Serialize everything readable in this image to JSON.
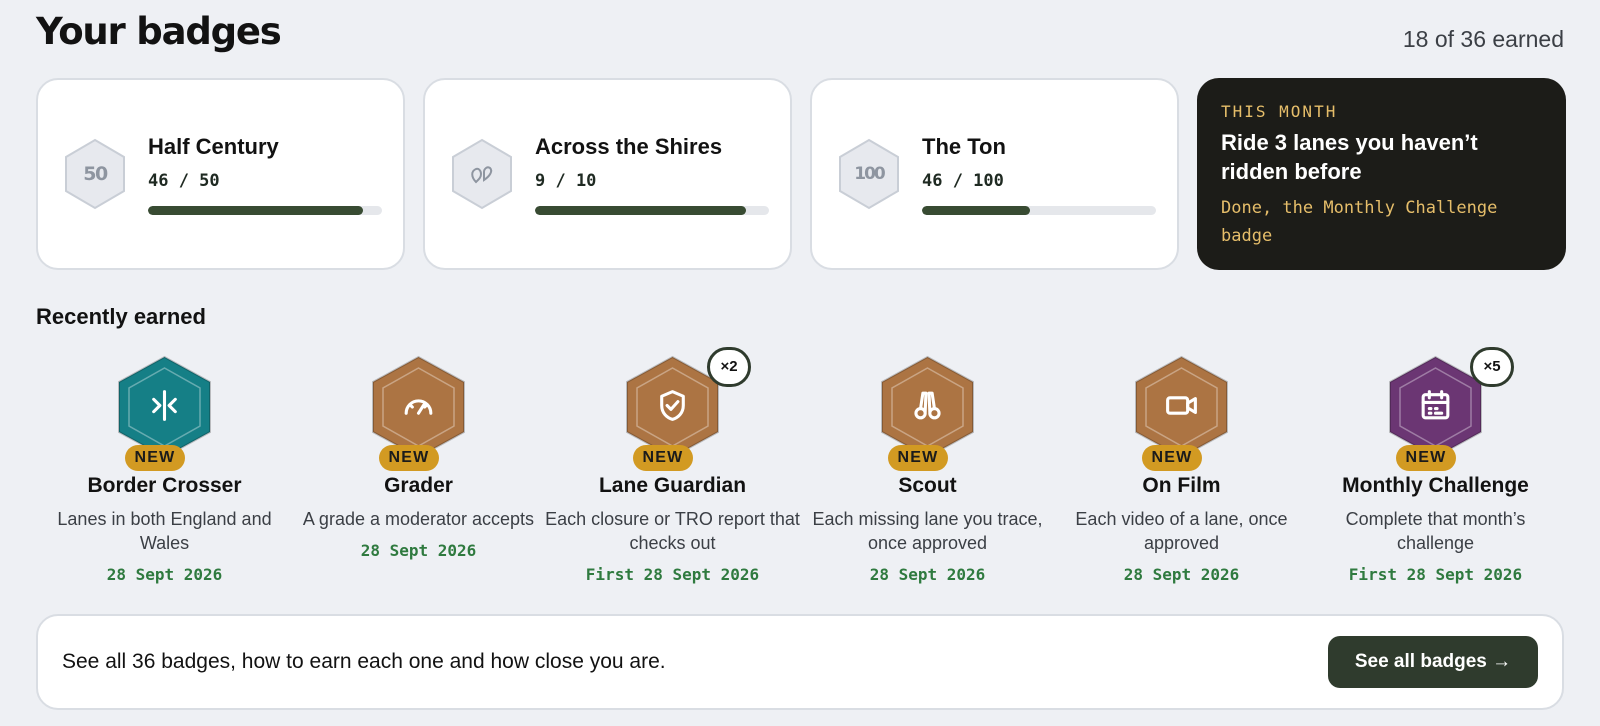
{
  "header": {
    "title": "Your badges",
    "earned_summary": "18 of 36 earned"
  },
  "progress": [
    {
      "icon_label": "50",
      "title": "Half Century",
      "count": "46 / 50",
      "progress": 0.92
    },
    {
      "icon_label": "",
      "icon": "map-pin-icon",
      "title": "Across the Shires",
      "count": "9 / 10",
      "progress": 0.9
    },
    {
      "icon_label": "100",
      "title": "The Ton",
      "count": "46 / 100",
      "progress": 0.46
    }
  ],
  "challenge": {
    "eyebrow": "THIS MONTH",
    "title": "Ride 3 lanes you haven’t ridden before",
    "status": "Done, the Monthly Challenge badge"
  },
  "recent": {
    "section_title": "Recently earned",
    "new_label": "NEW",
    "badges": [
      {
        "name": "Border Crosser",
        "description": "Lanes in both England and Wales",
        "date": "28 Sept 2026",
        "icon": "border-crossing-icon",
        "color": "#157f86",
        "multiplier": ""
      },
      {
        "name": "Grader",
        "description": "A grade a moderator accepts",
        "date": "28 Sept 2026",
        "icon": "gauge-icon",
        "color": "#ac7443",
        "multiplier": ""
      },
      {
        "name": "Lane Guardian",
        "description": "Each closure or TRO report that checks out",
        "date": "First 28 Sept 2026",
        "icon": "shield-check-icon",
        "color": "#ac7443",
        "multiplier": "×2"
      },
      {
        "name": "Scout",
        "description": "Each missing lane you trace, once approved",
        "date": "28 Sept 2026",
        "icon": "binoculars-icon",
        "color": "#ac7443",
        "multiplier": ""
      },
      {
        "name": "On Film",
        "description": "Each video of a lane, once approved",
        "date": "28 Sept 2026",
        "icon": "video-camera-icon",
        "color": "#ac7443",
        "multiplier": ""
      },
      {
        "name": "Monthly Challenge",
        "description": "Complete that month’s challenge",
        "date": "First 28 Sept 2026",
        "icon": "calendar-icon",
        "color": "#6b3673",
        "multiplier": "×5"
      }
    ]
  },
  "cta": {
    "text": "See all 36 badges, how to earn each one and how close you are.",
    "button_label": "See all badges →"
  },
  "colors": {
    "accent_dark": "#2f3b2d",
    "progress_fill": "#384b32",
    "new_pill": "#d29a22",
    "date_green": "#2f7a3f",
    "challenge_bg": "#1c1c18",
    "challenge_accent": "#e6be6a"
  }
}
